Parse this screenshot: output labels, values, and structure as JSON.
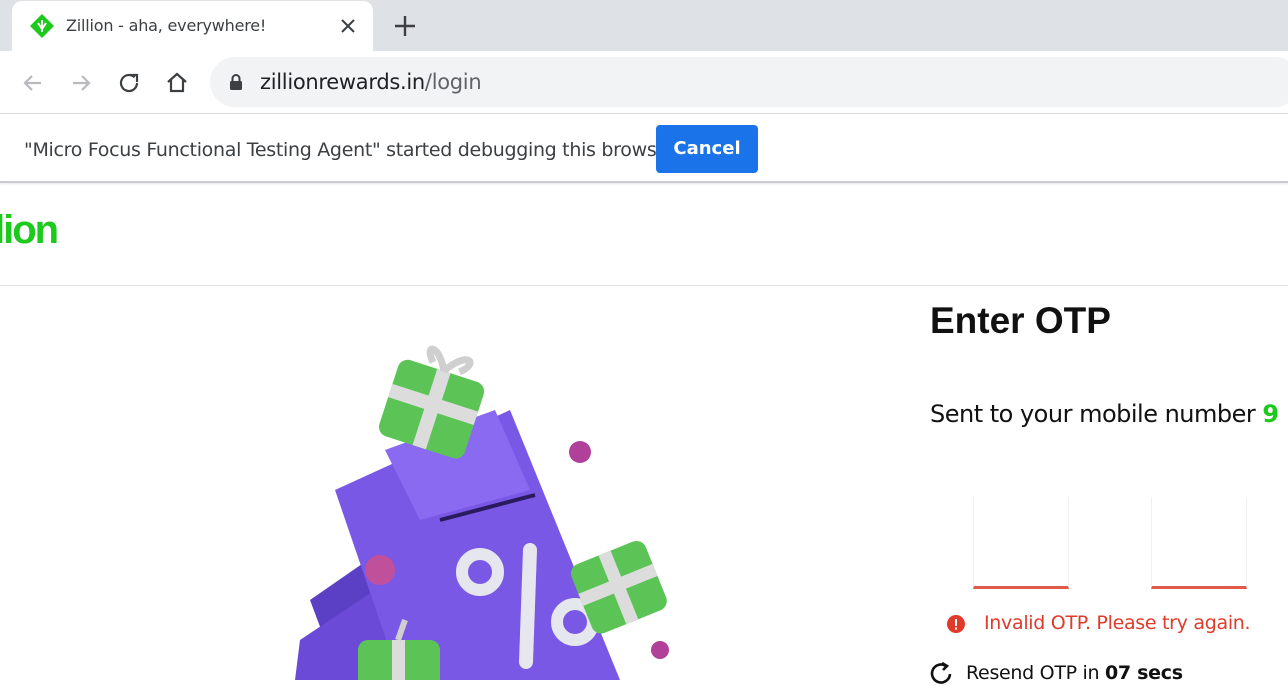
{
  "browser": {
    "tab_title": "Zillion - aha, everywhere!",
    "url_host": "zillionrewards.in",
    "url_path": "/login",
    "infobar_text": "\"Micro Focus Functional Testing Agent\" started debugging this browser",
    "infobar_button": "Cancel"
  },
  "site": {
    "logo_text": "lion",
    "accent_color": "#1ec91e"
  },
  "otp": {
    "title": "Enter OTP",
    "sent_label": "Sent to your mobile number",
    "mobile_prefix": "9",
    "boxes": [
      "",
      ""
    ],
    "error_text": "Invalid OTP. Please try again.",
    "resend_prefix": "Resend OTP in",
    "resend_time": "07 secs",
    "error_color": "#e03a2a"
  }
}
